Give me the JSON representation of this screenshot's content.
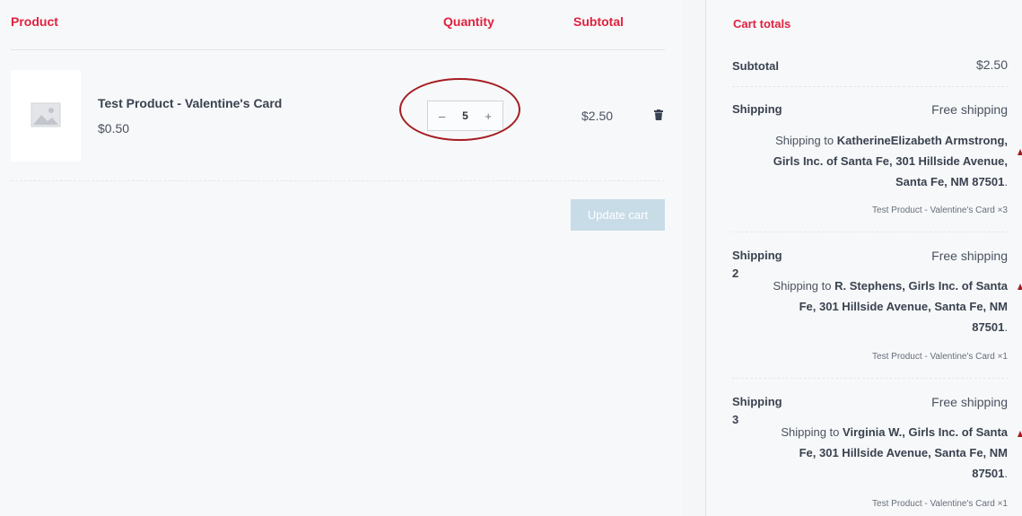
{
  "columns": {
    "product": "Product",
    "quantity": "Quantity",
    "subtotal": "Subtotal"
  },
  "item": {
    "name": "Test Product - Valentine's Card",
    "price": "$0.50",
    "quantity": "5",
    "minus": "–",
    "plus": "+",
    "line_subtotal": "$2.50"
  },
  "update_cart": "Update cart",
  "totals": {
    "title": "Cart totals",
    "subtotal_label": "Subtotal",
    "subtotal_value": "$2.50",
    "shipments": [
      {
        "label": "Shipping",
        "method": "Free shipping",
        "prefix": "Shipping to",
        "address": "KatherineElizabeth Armstrong, Girls Inc. of Santa Fe, 301 Hillside Avenue, Santa Fe, NM 87501",
        "suffix": ".",
        "items": "Test Product - Valentine's Card ×3"
      },
      {
        "label": "Shipping 2",
        "method": "Free shipping",
        "prefix": "Shipping to",
        "address": "R. Stephens, Girls Inc. of Santa Fe, 301 Hillside Avenue, Santa Fe, NM 87501",
        "suffix": ".",
        "items": "Test Product - Valentine's Card ×1"
      },
      {
        "label": "Shipping 3",
        "method": "Free shipping",
        "prefix": "Shipping to",
        "address": "Virginia W., Girls Inc. of Santa Fe, 301 Hillside Avenue, Santa Fe, NM 87501",
        "suffix": ".",
        "items": "Test Product - Valentine's Card ×1"
      }
    ]
  },
  "colors": {
    "accent": "#e0213f",
    "annotation": "#a41c20",
    "button_disabled": "#c8dce8"
  },
  "icons": {
    "thumbnail": "image-placeholder-icon",
    "remove": "trash-icon"
  }
}
